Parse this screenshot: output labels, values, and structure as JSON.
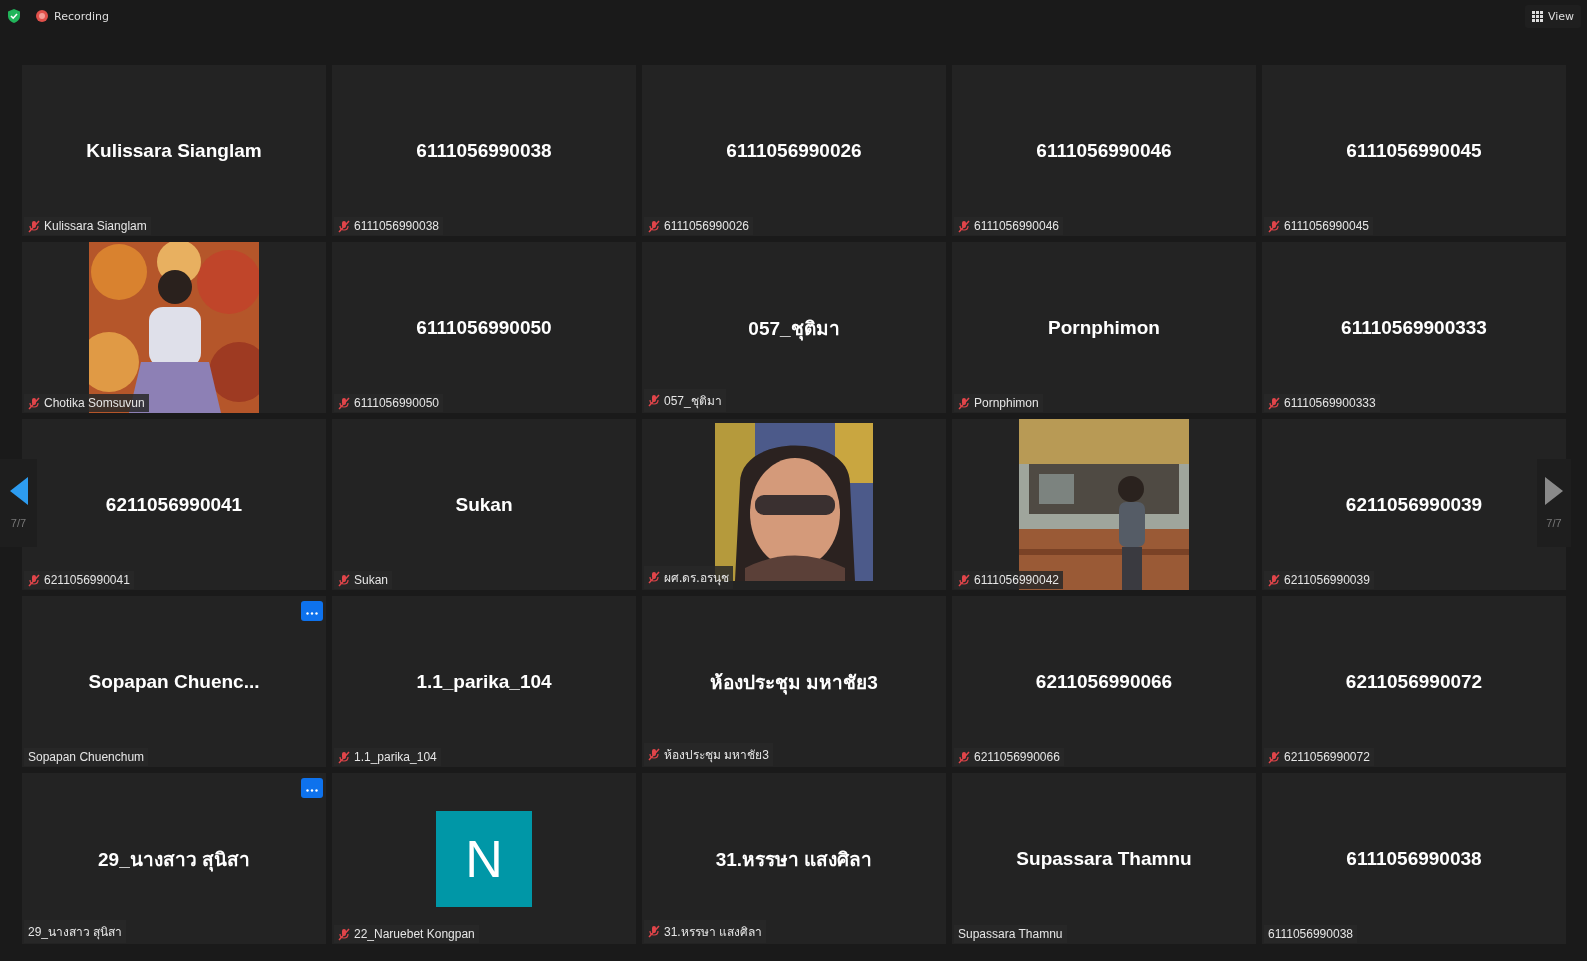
{
  "top_bar": {
    "recording_label": "Recording",
    "view_button": "View"
  },
  "navigation": {
    "previous": {
      "page": "7/7",
      "enabled": true
    },
    "next": {
      "page": "7/7",
      "enabled": false
    }
  },
  "tiles": [
    {
      "kind": "name",
      "display": "Kulissara Sianglam",
      "label": "Kulissara Sianglam",
      "muted": true,
      "more_button": false
    },
    {
      "kind": "name",
      "display": "6111056990038",
      "label": "6111056990038",
      "muted": true,
      "more_button": false
    },
    {
      "kind": "name",
      "display": "6111056990026",
      "label": "6111056990026",
      "muted": true,
      "more_button": false
    },
    {
      "kind": "name",
      "display": "6111056990046",
      "label": "6111056990046",
      "muted": true,
      "more_button": false
    },
    {
      "kind": "name",
      "display": "6111056990045",
      "label": "6111056990045",
      "muted": true,
      "more_button": false
    },
    {
      "kind": "picture",
      "label": "Chotika Somsuvun",
      "muted": true,
      "more_button": false
    },
    {
      "kind": "name",
      "display": "6111056990050",
      "label": "6111056990050",
      "muted": true,
      "more_button": false
    },
    {
      "kind": "name",
      "display": "057_ชุติมา",
      "label": "057_ชุติมา",
      "muted": true,
      "more_button": false
    },
    {
      "kind": "name",
      "display": "Pornphimon",
      "label": "Pornphimon",
      "muted": true,
      "more_button": false
    },
    {
      "kind": "name",
      "display": "61110569900333",
      "label": "61110569900333",
      "muted": true,
      "more_button": false
    },
    {
      "kind": "name",
      "display": "6211056990041",
      "label": "6211056990041",
      "muted": true,
      "more_button": false
    },
    {
      "kind": "name",
      "display": "Sukan",
      "label": "Sukan",
      "muted": true,
      "more_button": false
    },
    {
      "kind": "picture",
      "label": "ผศ.ดร.อรนุช",
      "muted": true,
      "more_button": false
    },
    {
      "kind": "picture",
      "label": "6111056990042",
      "muted": true,
      "more_button": false
    },
    {
      "kind": "name",
      "display": "6211056990039",
      "label": "6211056990039",
      "muted": true,
      "more_button": false
    },
    {
      "kind": "name",
      "display": "Sopapan  Chuenc...",
      "label": "Sopapan Chuenchum",
      "muted": false,
      "more_button": true
    },
    {
      "kind": "name",
      "display": "1.1_parika_104",
      "label": "1.1_parika_104",
      "muted": true,
      "more_button": false
    },
    {
      "kind": "name",
      "display": "ห้องประชุม มหาชัย3",
      "label": "ห้องประชุม มหาชัย3",
      "muted": true,
      "more_button": false
    },
    {
      "kind": "name",
      "display": "6211056990066",
      "label": "6211056990066",
      "muted": true,
      "more_button": false
    },
    {
      "kind": "name",
      "display": "6211056990072",
      "label": "6211056990072",
      "muted": true,
      "more_button": false
    },
    {
      "kind": "name",
      "display": "29_นางสาว สุนิสา",
      "label": "29_นางสาว สุนิสา",
      "muted": false,
      "more_button": true
    },
    {
      "kind": "avatar",
      "initial": "N",
      "label": "22_Naruebet Kongpan",
      "muted": true,
      "more_button": false
    },
    {
      "kind": "name",
      "display": "31.หรรษา แสงศิลา",
      "label": "31.หรรษา แสงศิลา",
      "muted": true,
      "more_button": false
    },
    {
      "kind": "name",
      "display": "Supassara Thamnu",
      "label": "Supassara Thamnu",
      "muted": false,
      "more_button": false
    },
    {
      "kind": "name",
      "display": "6111056990038",
      "label": "6111056990038",
      "muted": false,
      "more_button": false
    }
  ]
}
